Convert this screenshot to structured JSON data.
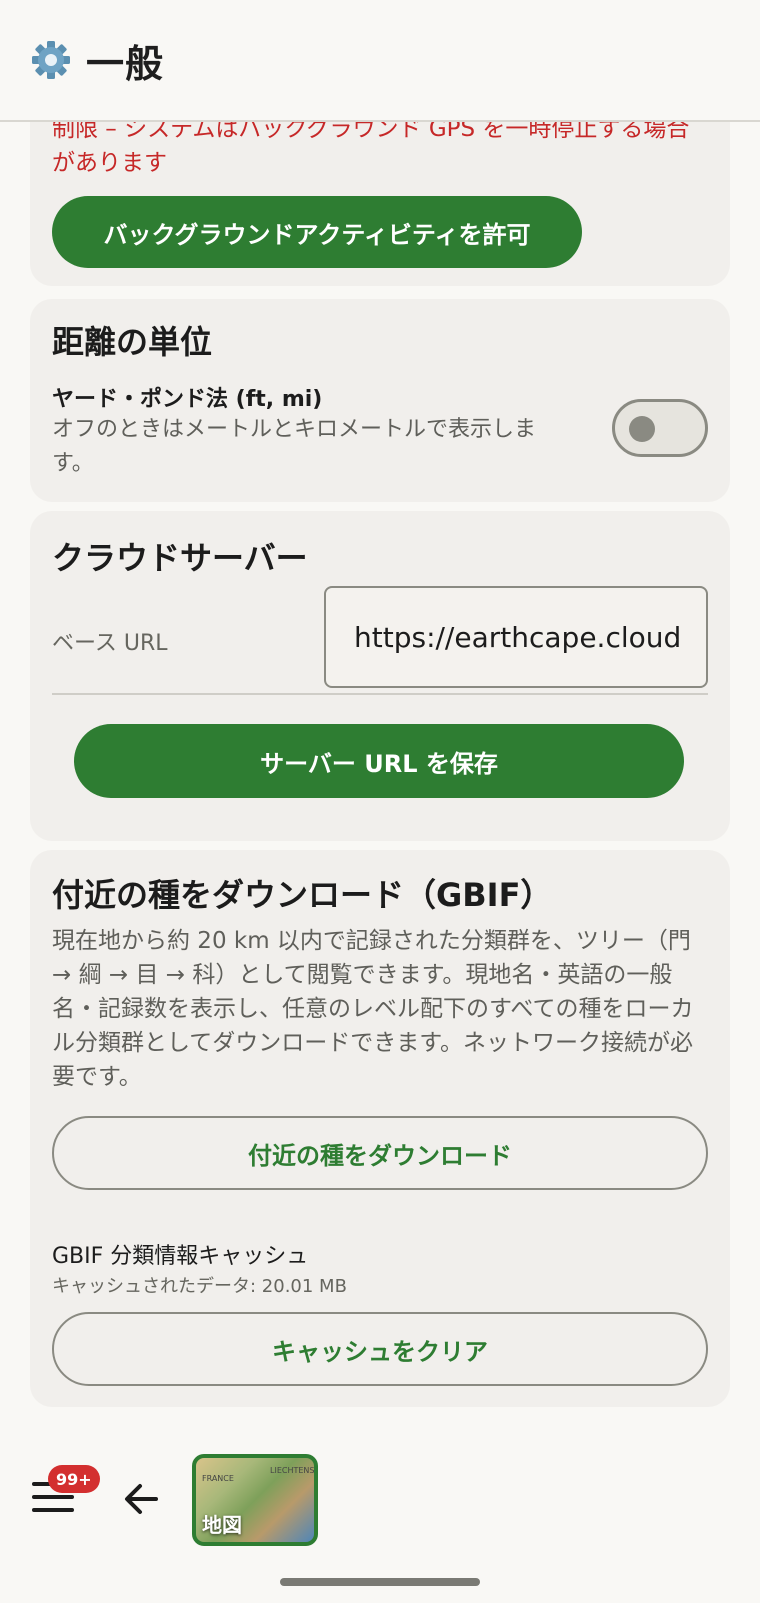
{
  "header": {
    "title": "一般",
    "icon": "gear-icon"
  },
  "background_section": {
    "warning_text": "制限 – システムはバックグラウンド GPS を一時停止する場合があります",
    "allow_button": "バックグラウンドアクティビティを許可"
  },
  "distance_section": {
    "title": "距離の単位",
    "option_label": "ヤード・ポンド法 (ft, mi)",
    "option_desc": "オフのときはメートルとキロメートルで表示します。",
    "toggle_on": false
  },
  "cloud_section": {
    "title": "クラウドサーバー",
    "url_label": "ベース URL",
    "url_value": "https://earthcape.cloud",
    "save_button": "サーバー URL を保存"
  },
  "gbif_section": {
    "title": "付近の種をダウンロード（GBIF）",
    "description": "現在地から約 20 km 以内で記録された分類群を、ツリー（門 → 綱 → 目 → 科）として閲覧できます。現地名・英語の一般名・記録数を表示し、任意のレベル配下のすべての種をローカル分類群としてダウンロードできます。ネットワーク接続が必要です。",
    "download_button": "付近の種をダウンロード",
    "cache_title": "GBIF 分類情報キャッシュ",
    "cache_size": "キャッシュされたデータ: 20.01 MB",
    "clear_button": "キャッシュをクリア"
  },
  "bottom_nav": {
    "badge": "99+",
    "map_label": "地図",
    "map_text_1": "FRANCE",
    "map_text_2": "LIECHTENS"
  },
  "colors": {
    "accent": "#2e7d32",
    "warning": "#c62828",
    "badge": "#d32f2f"
  }
}
